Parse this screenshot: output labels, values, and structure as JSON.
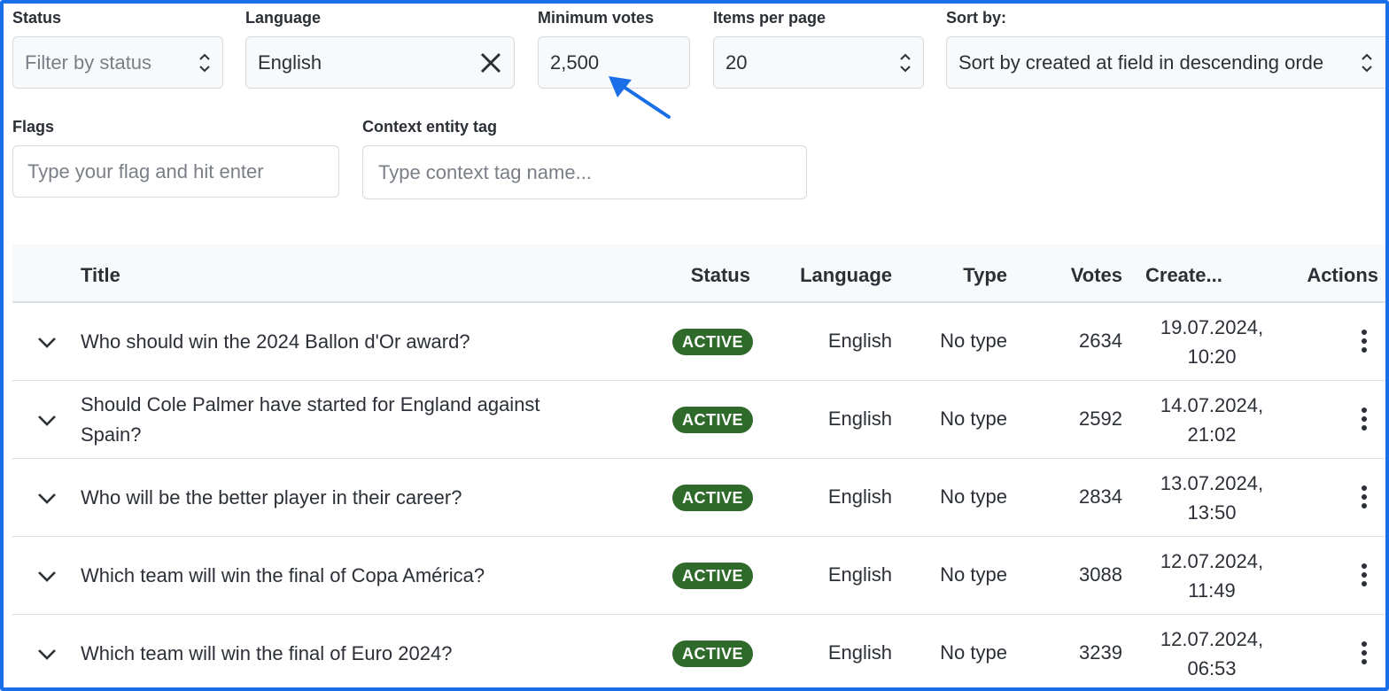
{
  "filters": {
    "status": {
      "label": "Status",
      "placeholder": "Filter by status"
    },
    "language": {
      "label": "Language",
      "value": "English"
    },
    "min_votes": {
      "label": "Minimum votes",
      "value": "2,500"
    },
    "items_per_page": {
      "label": "Items per page",
      "value": "20"
    },
    "sort_by": {
      "label": "Sort by:",
      "value": "Sort by created at field in descending orde"
    },
    "flags": {
      "label": "Flags",
      "placeholder": "Type your flag and hit enter"
    },
    "context_tag": {
      "label": "Context entity tag",
      "placeholder": "Type context tag name..."
    }
  },
  "table": {
    "columns": {
      "title": "Title",
      "status": "Status",
      "language": "Language",
      "type": "Type",
      "votes": "Votes",
      "created": "Create...",
      "actions": "Actions"
    },
    "rows": [
      {
        "title": [
          "Who should win the 2024 Ballon d'Or award?",
          ""
        ],
        "status": "ACTIVE",
        "language": "English",
        "type": "No type",
        "votes": "2634",
        "date": "19.07.2024,",
        "time": "10:20"
      },
      {
        "title": [
          "Should Cole Palmer have started for England against",
          "Spain?"
        ],
        "status": "ACTIVE",
        "language": "English",
        "type": "No type",
        "votes": "2592",
        "date": "14.07.2024,",
        "time": "21:02"
      },
      {
        "title": [
          "Who will be the better player in their career?",
          ""
        ],
        "status": "ACTIVE",
        "language": "English",
        "type": "No type",
        "votes": "2834",
        "date": "13.07.2024,",
        "time": "13:50"
      },
      {
        "title": [
          "Which team will win the final of Copa América?",
          ""
        ],
        "status": "ACTIVE",
        "language": "English",
        "type": "No type",
        "votes": "3088",
        "date": "12.07.2024,",
        "time": "11:49"
      },
      {
        "title": [
          "Which team will win the final of Euro 2024?",
          ""
        ],
        "status": "ACTIVE",
        "language": "English",
        "type": "No type",
        "votes": "3239",
        "date": "12.07.2024,",
        "time": "06:53"
      }
    ]
  },
  "colors": {
    "frame_border": "#1a6ee8",
    "arrow": "#1a6ee8",
    "badge_active": "#2e6b2a"
  },
  "icons": {
    "select_arrows": "updown-chevron-icon",
    "clear": "close-icon",
    "expand": "chevron-down-icon",
    "actions": "kebab-menu-icon",
    "annotation": "arrow-icon"
  }
}
